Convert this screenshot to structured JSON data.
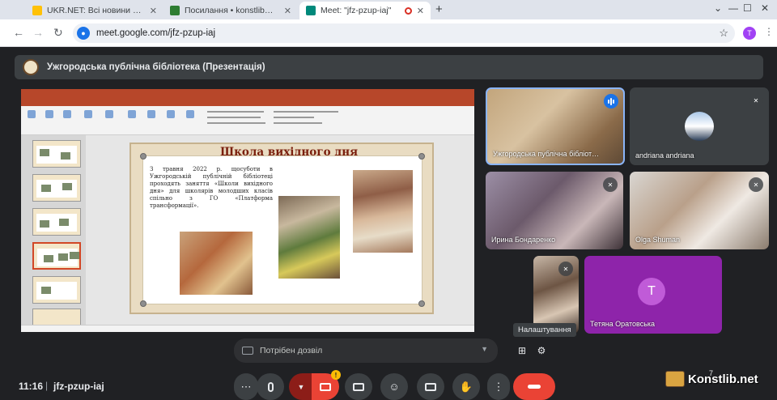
{
  "browser": {
    "tabs": [
      {
        "label": "UKR.NET: Всі новини України, ",
        "favicon_color": "#ffc107"
      },
      {
        "label": "Посилання • konstlib@ukr.net",
        "favicon_color": "#2e7d32"
      },
      {
        "label": "Meet: \"jfz-pzup-iaj\"",
        "favicon_color": "#00897b"
      }
    ],
    "new_tab": "+",
    "window_controls": {
      "collapse": "⌄",
      "minimize": "—",
      "maximize": "☐",
      "close": "✕"
    },
    "url": "meet.google.com/jfz-pzup-iaj",
    "profile_letter": "T"
  },
  "meet": {
    "presentation_title": "Ужгородська публічна бібліотека (Презентація)",
    "slide": {
      "title": "Школа вихідного дня",
      "body": "З травня 2022 р. щосуботи в Ужгородській публічній бібліотеці проходять заняття «Школи вихідного дня» для школярів молодших класів спільно з ГО «Платформа трансформації»."
    },
    "participants": [
      {
        "name": "Ужгородська публічна бібліот…",
        "speaking": true
      },
      {
        "name": "andriana andriana",
        "muted": true
      },
      {
        "name": "Ирина Бондаренко",
        "muted": true
      },
      {
        "name": "Olga Shuman",
        "muted": true
      },
      {
        "name": "",
        "muted": true
      },
      {
        "name": "Тетяна Оратовська",
        "avatar_letter": "T",
        "avatar_color": "#c05bd8",
        "tile_color": "#8e24aa"
      }
    ],
    "tooltip": "Налаштування",
    "permission_text": "Потрібен дозвіл",
    "time": "11:16",
    "separator": "|",
    "meeting_code": "jfz-pzup-iaj",
    "participants_count": "7",
    "warning": "!"
  },
  "watermark": "Konstlib.net",
  "colors": {
    "background": "#202124",
    "hangup": "#ea4335",
    "accent": "#1a73e8"
  }
}
